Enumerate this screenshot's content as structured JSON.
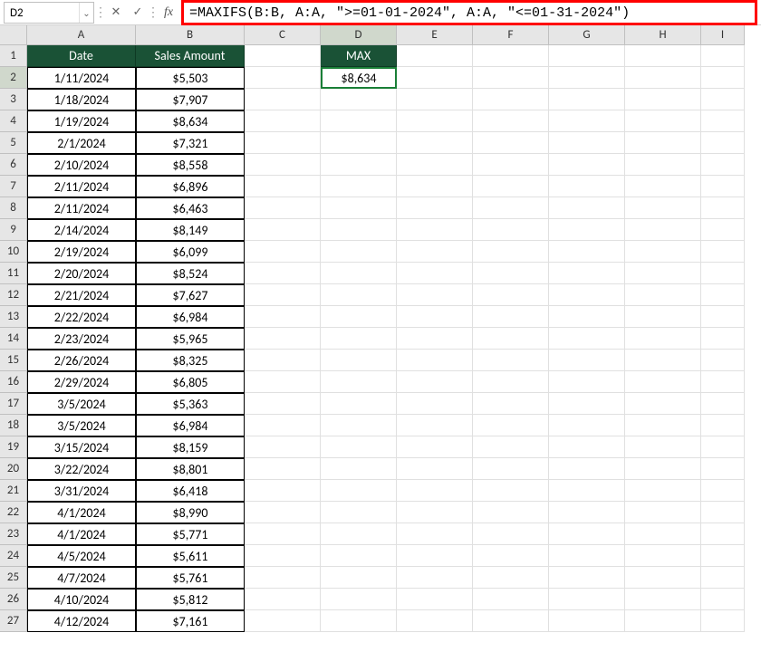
{
  "name_box": "D2",
  "formula": "=MAXIFS(B:B, A:A, \">=01-01-2024\", A:A, \"<=01-31-2024\")",
  "columns": [
    "A",
    "B",
    "C",
    "D",
    "E",
    "F",
    "G",
    "H",
    "I"
  ],
  "active_column": "D",
  "header_row": {
    "A": "Date",
    "B": "Sales Amount",
    "D": "MAX"
  },
  "d2_value": "$8,634",
  "rows": [
    {
      "n": 2,
      "date": "1/11/2024",
      "amount": "$5,503"
    },
    {
      "n": 3,
      "date": "1/18/2024",
      "amount": "$7,907"
    },
    {
      "n": 4,
      "date": "1/19/2024",
      "amount": "$8,634"
    },
    {
      "n": 5,
      "date": "2/1/2024",
      "amount": "$7,321"
    },
    {
      "n": 6,
      "date": "2/10/2024",
      "amount": "$8,558"
    },
    {
      "n": 7,
      "date": "2/11/2024",
      "amount": "$6,896"
    },
    {
      "n": 8,
      "date": "2/11/2024",
      "amount": "$6,463"
    },
    {
      "n": 9,
      "date": "2/14/2024",
      "amount": "$8,149"
    },
    {
      "n": 10,
      "date": "2/19/2024",
      "amount": "$6,099"
    },
    {
      "n": 11,
      "date": "2/20/2024",
      "amount": "$8,524"
    },
    {
      "n": 12,
      "date": "2/21/2024",
      "amount": "$7,627"
    },
    {
      "n": 13,
      "date": "2/22/2024",
      "amount": "$6,984"
    },
    {
      "n": 14,
      "date": "2/23/2024",
      "amount": "$5,965"
    },
    {
      "n": 15,
      "date": "2/26/2024",
      "amount": "$8,325"
    },
    {
      "n": 16,
      "date": "2/29/2024",
      "amount": "$6,805"
    },
    {
      "n": 17,
      "date": "3/5/2024",
      "amount": "$5,363"
    },
    {
      "n": 18,
      "date": "3/5/2024",
      "amount": "$6,984"
    },
    {
      "n": 19,
      "date": "3/15/2024",
      "amount": "$8,159"
    },
    {
      "n": 20,
      "date": "3/22/2024",
      "amount": "$8,801"
    },
    {
      "n": 21,
      "date": "3/31/2024",
      "amount": "$6,418"
    },
    {
      "n": 22,
      "date": "4/1/2024",
      "amount": "$8,990"
    },
    {
      "n": 23,
      "date": "4/1/2024",
      "amount": "$5,771"
    },
    {
      "n": 24,
      "date": "4/5/2024",
      "amount": "$5,611"
    },
    {
      "n": 25,
      "date": "4/7/2024",
      "amount": "$5,761"
    },
    {
      "n": 26,
      "date": "4/10/2024",
      "amount": "$5,812"
    },
    {
      "n": 27,
      "date": "4/12/2024",
      "amount": "$7,161"
    }
  ],
  "icons": {
    "dropdown": "⌄",
    "sep": "⋮",
    "cancel": "✕",
    "confirm": "✓",
    "fx": "fx"
  }
}
